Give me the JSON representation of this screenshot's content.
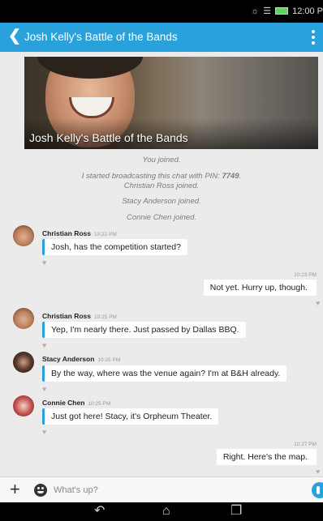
{
  "status_bar": {
    "time": "12:00 P",
    "icons": [
      "silent-icon",
      "wifi-icon",
      "battery-icon"
    ]
  },
  "app_bar": {
    "title": "Josh Kelly's Battle of the Bands",
    "back_icon": "chevron-left-icon",
    "menu_icon": "overflow-menu-icon"
  },
  "banner": {
    "title": "Josh Kelly's Battle of the Bands"
  },
  "system_messages": {
    "you_joined": "You joined.",
    "broadcast_prefix": "I started broadcasting this chat with PIN: ",
    "pin": "7749",
    "broadcast_suffix": ".",
    "christian_joined": "Christian Ross joined.",
    "stacy_joined": "Stacy Anderson joined.",
    "connie_joined": "Connie Chen joined."
  },
  "messages": [
    {
      "direction": "in",
      "sender": "Christian Ross",
      "time": "10:22 PM",
      "text": "Josh, has the competition started?"
    },
    {
      "direction": "out",
      "time": "10:23 PM",
      "text": "Not yet. Hurry up, though."
    },
    {
      "direction": "in",
      "sender": "Christian Ross",
      "time": "10:25 PM",
      "text": "Yep, I'm nearly there. Just passed by Dallas BBQ."
    },
    {
      "direction": "in",
      "sender": "Stacy Anderson",
      "time": "10:25 PM",
      "text": "By the way, where was the venue again? I'm at B&H already."
    },
    {
      "direction": "in",
      "sender": "Connie Chen",
      "time": "10:25 PM",
      "text": "Just got here! Stacy, it's Orpheum Theater."
    },
    {
      "direction": "out",
      "time": "10:27 PM",
      "text": "Right. Here's the map."
    }
  ],
  "composer": {
    "placeholder": "What's up?"
  },
  "colors": {
    "accent": "#29a2dc",
    "background": "#ebebeb",
    "bubble": "#ffffff"
  }
}
